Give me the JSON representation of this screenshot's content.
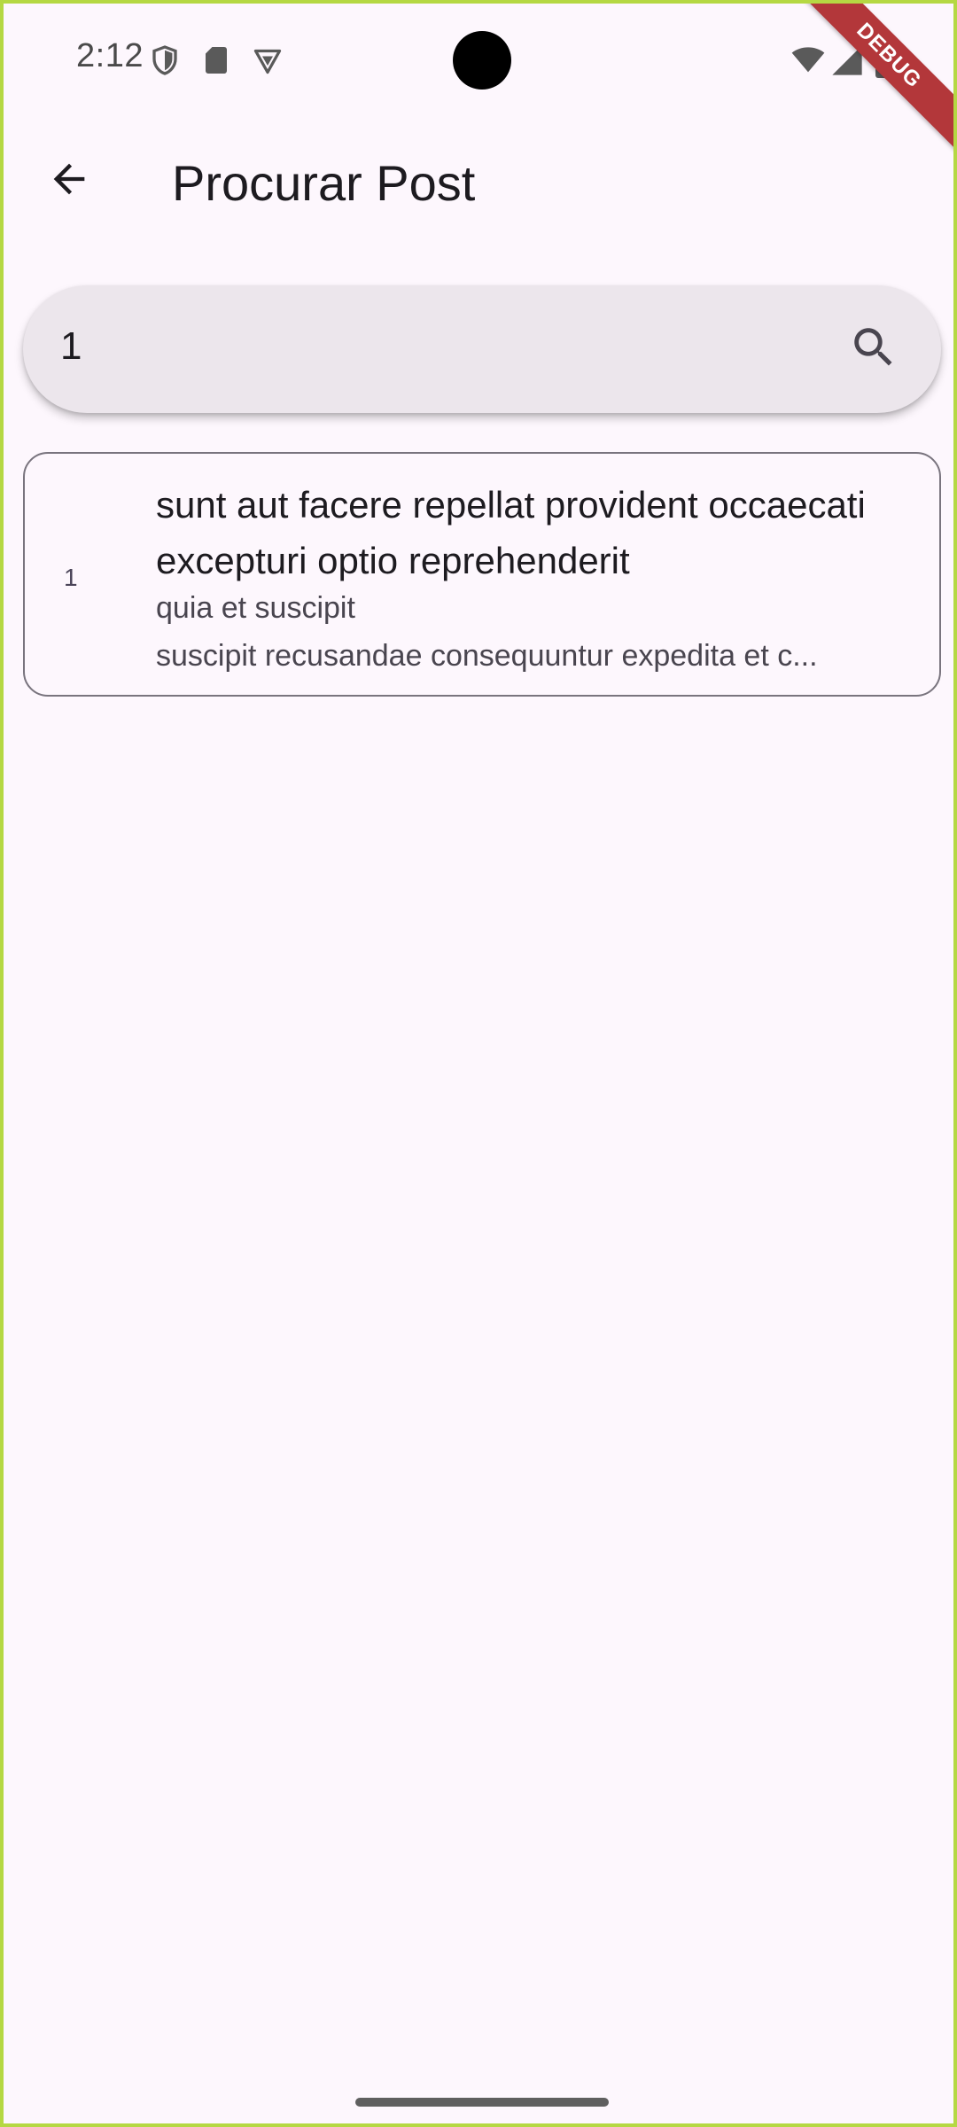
{
  "status_bar": {
    "time": "2:12",
    "icons": [
      "shield-icon",
      "sd-card-icon",
      "vpn-icon",
      "wifi-icon",
      "cell-signal-icon",
      "battery-icon"
    ]
  },
  "debug_banner": {
    "label": "DEBUG"
  },
  "app_bar": {
    "title": "Procurar Post",
    "back_icon": "arrow-left-icon"
  },
  "search": {
    "value": "1",
    "icon": "search-icon"
  },
  "results": [
    {
      "id": "1",
      "title": "sunt aut facere repellat provident occaecati excepturi optio reprehenderit",
      "body_line_1": "quia et suscipit",
      "body_line_2": "suscipit recusandae consequuntur expedita et c..."
    }
  ],
  "colors": {
    "background": "#fdf7fd",
    "search_fill": "#ece6ec",
    "outline": "#79747e",
    "debug_banner": "#b3373a",
    "frame": "#b5d843"
  }
}
